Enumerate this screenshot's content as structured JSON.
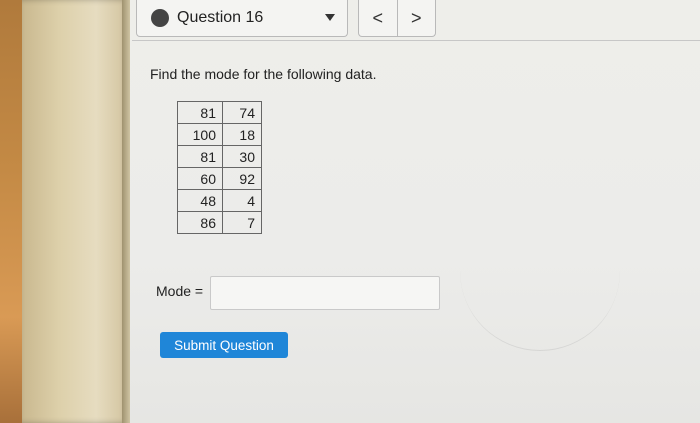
{
  "header": {
    "question_selector": "Question 16",
    "prev_icon": "chevron-left",
    "next_icon": "chevron-right",
    "dropdown_icon": "caret-down"
  },
  "question": {
    "prompt": "Find the mode for the following data.",
    "table": [
      [
        "81",
        "74"
      ],
      [
        "100",
        "18"
      ],
      [
        "81",
        "30"
      ],
      [
        "60",
        "92"
      ],
      [
        "48",
        "4"
      ],
      [
        "86",
        "7"
      ]
    ]
  },
  "answer": {
    "label": "Mode =",
    "value": ""
  },
  "submit": {
    "label": "Submit Question",
    "color": "#1f86d8"
  },
  "nav": {
    "prev_glyph": "<",
    "next_glyph": ">"
  }
}
